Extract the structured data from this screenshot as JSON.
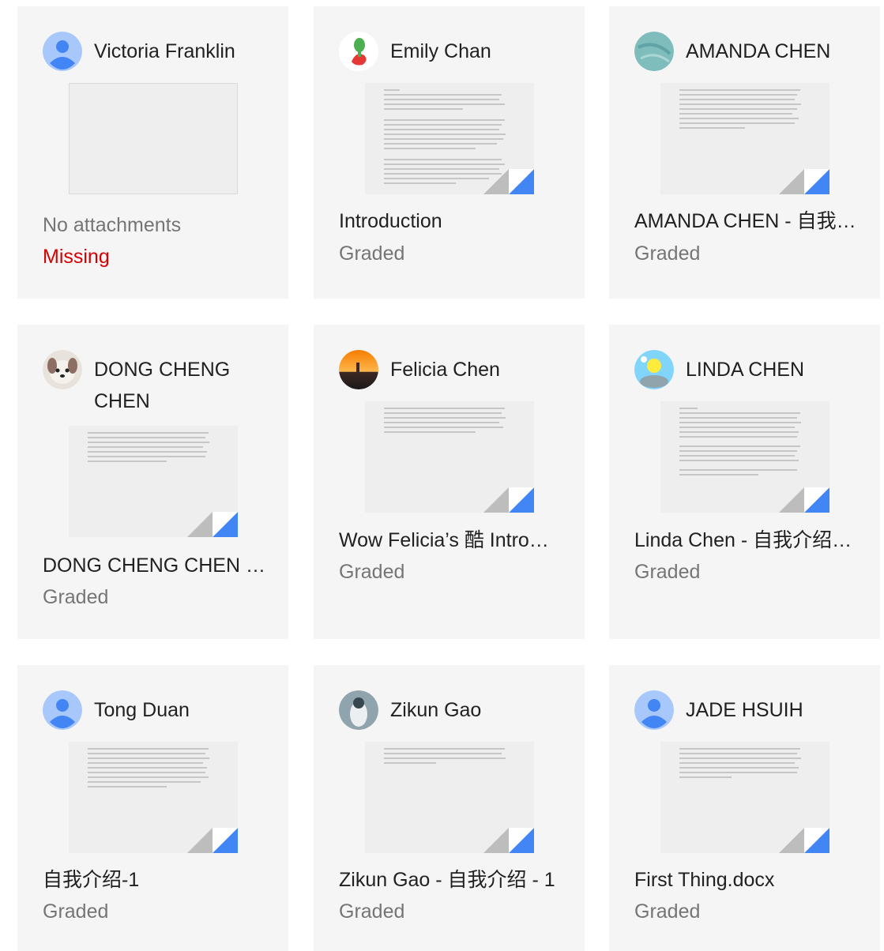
{
  "colors": {
    "card_bg": "#f5f5f5",
    "missing": "#d50000",
    "doc_corner": "#4285f4"
  },
  "cards": [
    {
      "name": "Victoria Franklin",
      "title": "No attachments",
      "status": "Missing",
      "avatar": "default-avatar-icon"
    },
    {
      "name": "Emily Chan",
      "title": "Introduction",
      "status": "Graded",
      "avatar": "profile-photo"
    },
    {
      "name": "AMANDA CHEN",
      "title": "AMANDA CHEN - 自我…",
      "status": "Graded",
      "avatar": "profile-photo"
    },
    {
      "name_line1": "DONG CHENG",
      "name_line2": "CHEN",
      "title": "DONG CHENG CHEN -…",
      "status": "Graded",
      "avatar": "profile-photo"
    },
    {
      "name": "Felicia Chen",
      "title": "Wow Felicia’s 酷 Intro…",
      "status": "Graded",
      "avatar": "profile-photo"
    },
    {
      "name": "LINDA CHEN",
      "title": "Linda Chen - 自我介绍…",
      "status": "Graded",
      "avatar": "profile-photo"
    },
    {
      "name": "Tong Duan",
      "title": "自我介绍-1",
      "status": "Graded",
      "avatar": "default-avatar-icon"
    },
    {
      "name": "Zikun Gao",
      "title": "Zikun Gao - 自我介绍 - 1",
      "status": "Graded",
      "avatar": "profile-photo"
    },
    {
      "name": "JADE HSUIH",
      "title": "First Thing.docx",
      "status": "Graded",
      "avatar": "default-avatar-icon"
    }
  ]
}
